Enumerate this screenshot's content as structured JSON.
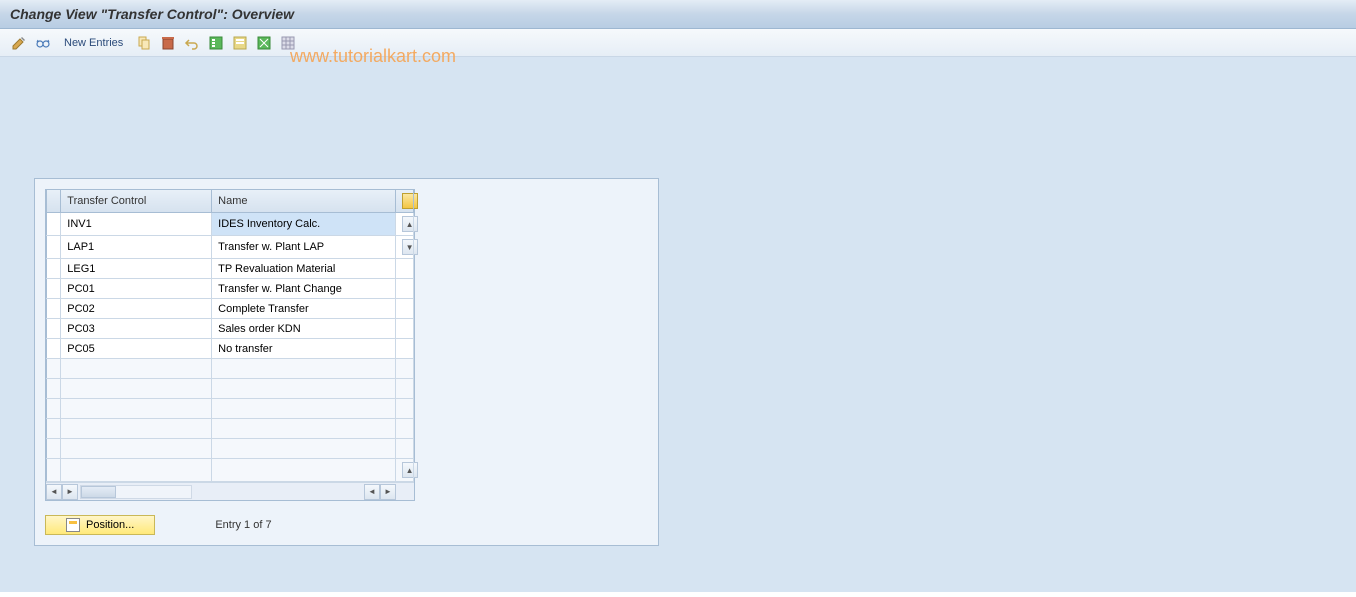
{
  "title": "Change View \"Transfer Control\": Overview",
  "toolbar": {
    "new_entries_label": "New Entries"
  },
  "watermark": "www.tutorialkart.com",
  "table": {
    "headers": {
      "tc": "Transfer Control",
      "name": "Name"
    },
    "rows": [
      {
        "tc": "INV1",
        "name": "IDES Inventory Calc.",
        "selected": true
      },
      {
        "tc": "LAP1",
        "name": "Transfer w. Plant LAP",
        "selected": false
      },
      {
        "tc": "LEG1",
        "name": "TP Revaluation Material",
        "selected": false
      },
      {
        "tc": "PC01",
        "name": "Transfer w. Plant Change",
        "selected": false
      },
      {
        "tc": "PC02",
        "name": "Complete Transfer",
        "selected": false
      },
      {
        "tc": "PC03",
        "name": "Sales order KDN",
        "selected": false
      },
      {
        "tc": "PC05",
        "name": "No transfer",
        "selected": false
      }
    ],
    "empty_rows": 6
  },
  "footer": {
    "position_label": "Position...",
    "entry_text": "Entry 1 of 7"
  },
  "icons": {
    "pencil": "pencil-icon",
    "glasses": "glasses-icon",
    "copy": "copy-icon",
    "save": "save-icon",
    "undo": "undo-icon",
    "select_all": "select-all-icon",
    "select_block": "select-block-icon",
    "deselect_all": "deselect-all-icon"
  }
}
